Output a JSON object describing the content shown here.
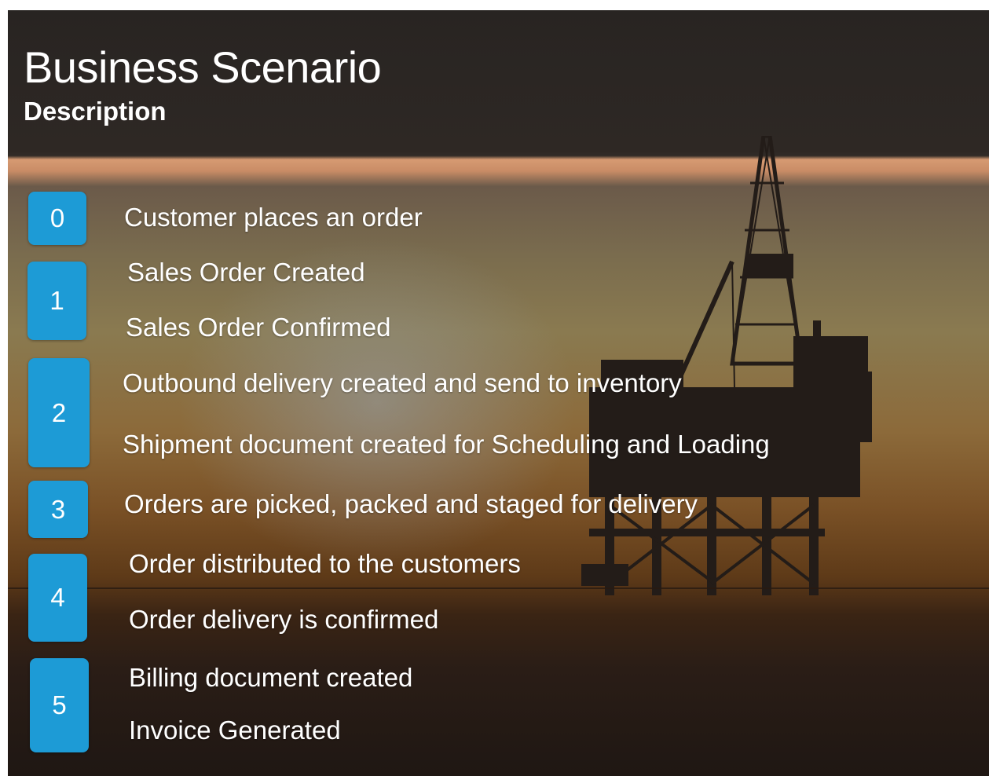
{
  "header": {
    "title": "Business Scenario",
    "subtitle": "Description"
  },
  "colors": {
    "badge": "#1d9bd6",
    "header_bg": "#2e2926",
    "text": "#ffffff"
  },
  "steps": [
    {
      "number": "0",
      "lines": [
        "Customer places an order"
      ]
    },
    {
      "number": "1",
      "lines": [
        "Sales Order Created",
        "Sales Order Confirmed"
      ]
    },
    {
      "number": "2",
      "lines": [
        "Outbound delivery created and send to inventory",
        "Shipment document created for Scheduling and Loading"
      ]
    },
    {
      "number": "3",
      "lines": [
        "Orders are picked, packed and staged for delivery"
      ]
    },
    {
      "number": "4",
      "lines": [
        "Order distributed to the customers",
        "Order delivery is confirmed"
      ]
    },
    {
      "number": "5",
      "lines": [
        "Billing document  created",
        "Invoice Generated"
      ]
    }
  ]
}
